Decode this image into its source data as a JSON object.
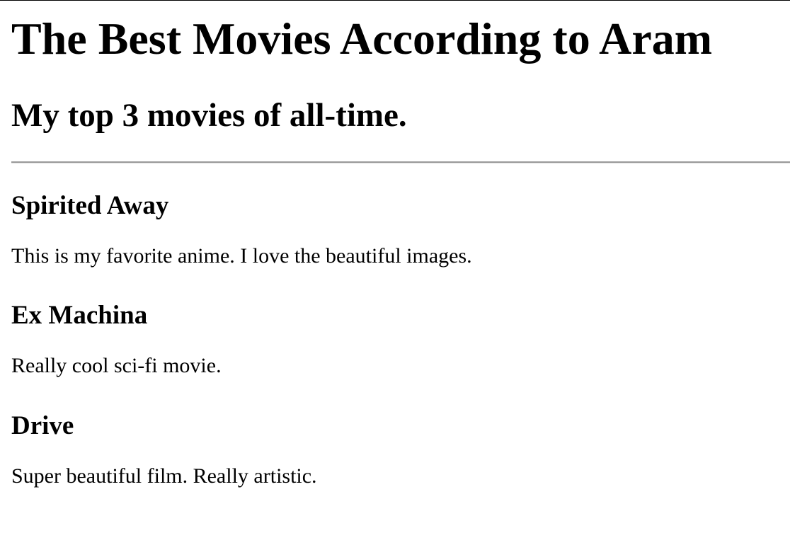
{
  "header": {
    "title": "The Best Movies According to Aram",
    "subtitle": "My top 3 movies of all-time."
  },
  "movies": [
    {
      "title": "Spirited Away",
      "description": "This is my favorite anime. I love the beautiful images."
    },
    {
      "title": "Ex Machina",
      "description": "Really cool sci-fi movie."
    },
    {
      "title": "Drive",
      "description": "Super beautiful film. Really artistic."
    }
  ]
}
